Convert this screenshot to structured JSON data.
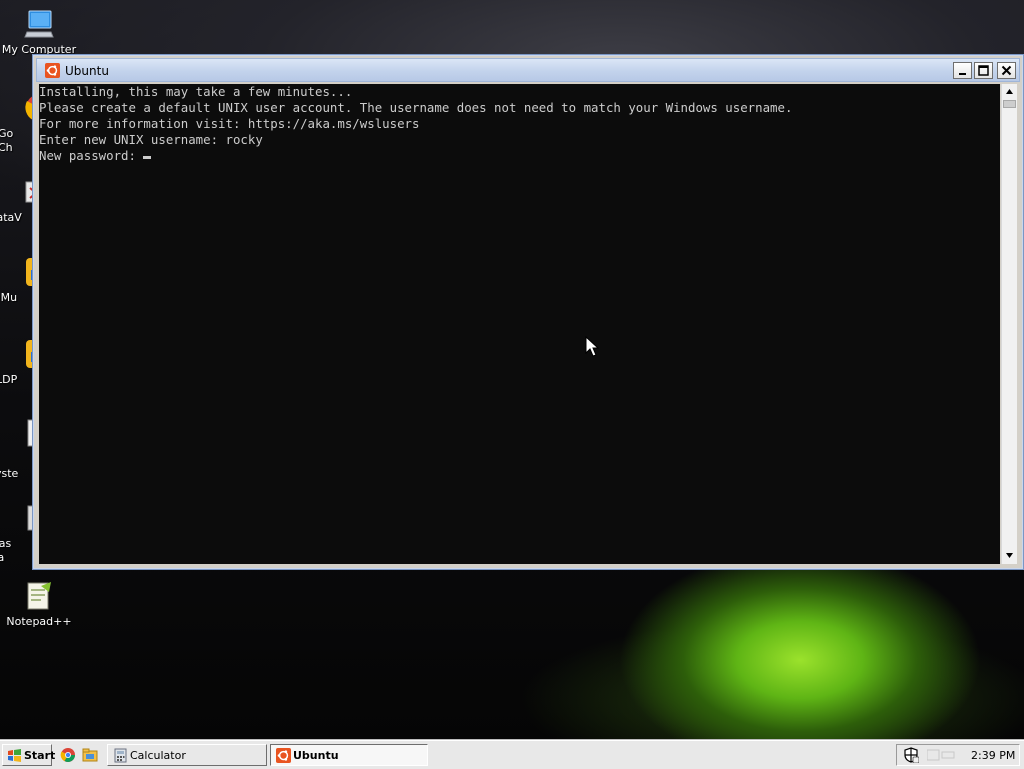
{
  "desktop": {
    "icons": [
      {
        "label": "My Computer",
        "icon": "computer-icon"
      },
      {
        "label": "Go\nCh",
        "icon": "chrome-icon"
      },
      {
        "label": "DataV",
        "icon": "datav-icon"
      },
      {
        "label": "LDMu",
        "icon": "ldmulti-icon"
      },
      {
        "label": "LDP",
        "icon": "ldplayer-icon"
      },
      {
        "label": "Cl\nSyste",
        "icon": "system-icon"
      },
      {
        "label": "Clas\nMa",
        "icon": "classic-icon"
      },
      {
        "label": "Notepad++",
        "icon": "notepadpp-icon"
      }
    ]
  },
  "window": {
    "title": "Ubuntu",
    "icon": "ubuntu-icon",
    "controls": [
      "minimize-icon",
      "maximize-icon",
      "close-icon"
    ]
  },
  "console": {
    "lines": [
      "Installing, this may take a few minutes...",
      "Please create a default UNIX user account. The username does not need to match your Windows username.",
      "For more information visit: https://aka.ms/wslusers",
      "Enter new UNIX username: rocky",
      "New password: "
    ]
  },
  "taskbar": {
    "start_label": "Start",
    "quick_launch": [
      "chrome-icon",
      "explorer-icon"
    ],
    "tasks": [
      {
        "label": "Calculator",
        "icon": "calculator-icon",
        "active": false
      },
      {
        "label": "Ubuntu",
        "icon": "ubuntu-icon",
        "active": true
      }
    ],
    "clock": "2:39 PM"
  },
  "colors": {
    "console_bg": "#0c0c0c",
    "console_fg": "#cccccc",
    "titlebar": "#c3d3ec",
    "ubuntu_orange": "#e95420"
  }
}
